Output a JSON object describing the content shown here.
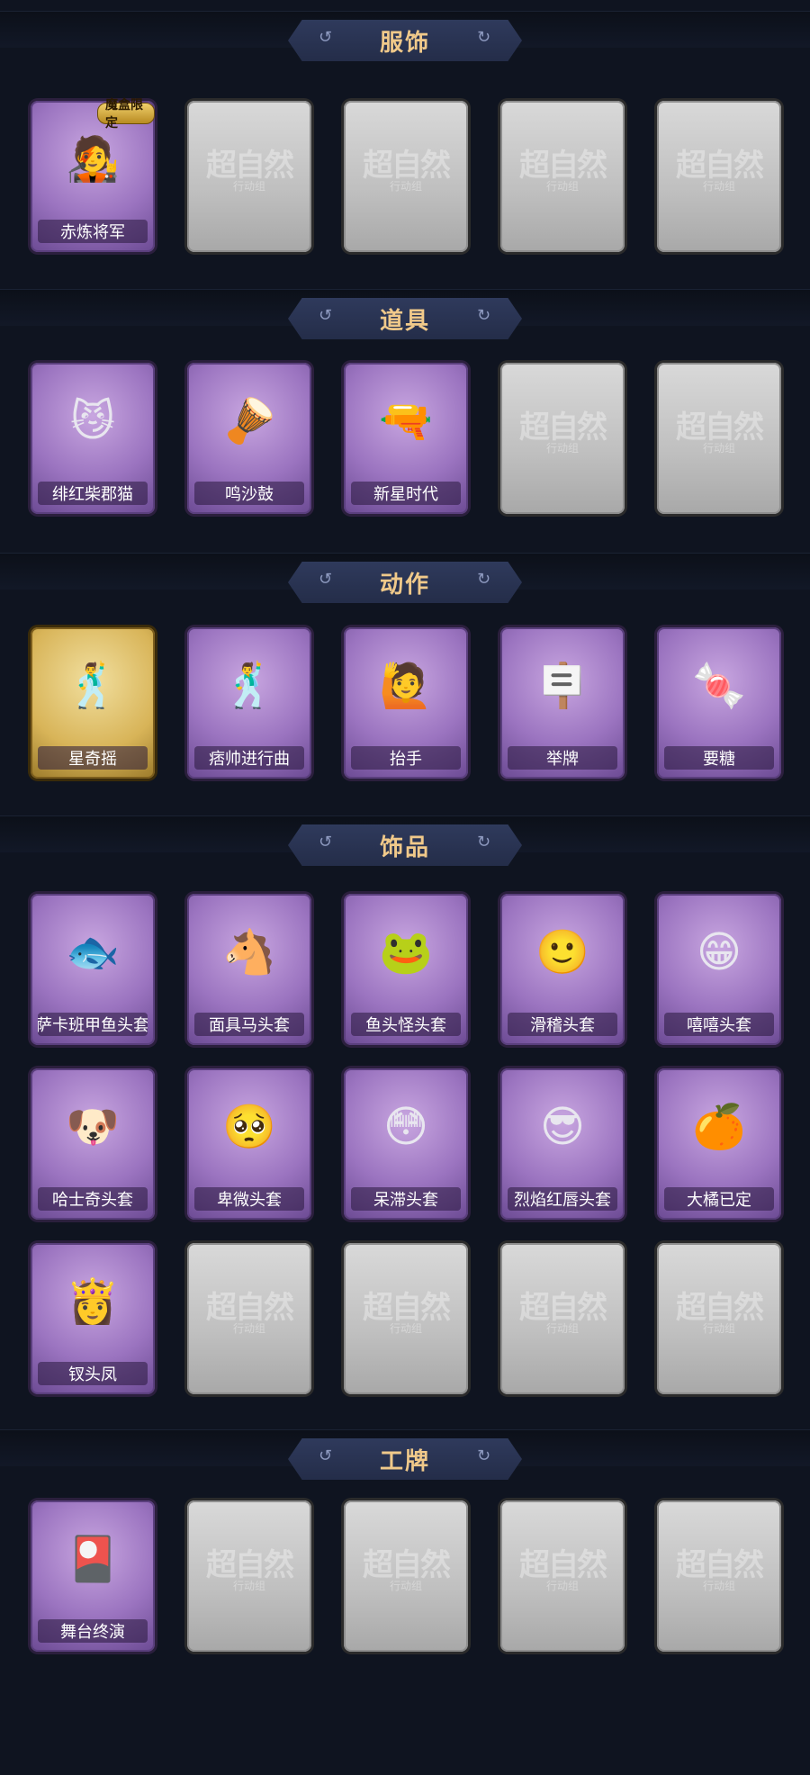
{
  "sections": [
    {
      "title": "服饰",
      "rows": [
        [
          {
            "type": "filled",
            "label": "赤炼将军",
            "icon": "red-hat-avatar-icon",
            "badge": "魔盒限定"
          },
          {
            "type": "empty",
            "watermark": "超自然",
            "watermark_sub": "行动组"
          },
          {
            "type": "empty",
            "watermark": "超自然",
            "watermark_sub": "行动组"
          },
          {
            "type": "empty",
            "watermark": "超自然",
            "watermark_sub": "行动组"
          },
          {
            "type": "empty",
            "watermark": "超自然",
            "watermark_sub": "行动组"
          }
        ]
      ]
    },
    {
      "title": "道具",
      "rows": [
        [
          {
            "type": "filled",
            "label": "绯红柴郡猫",
            "icon": "cheshire-cat-icon"
          },
          {
            "type": "filled",
            "label": "鸣沙鼓",
            "icon": "drum-charm-icon"
          },
          {
            "type": "filled",
            "label": "新星时代",
            "icon": "revolver-icon"
          },
          {
            "type": "empty",
            "watermark": "超自然",
            "watermark_sub": "行动组"
          },
          {
            "type": "empty",
            "watermark": "超自然",
            "watermark_sub": "行动组"
          }
        ]
      ]
    },
    {
      "title": "动作",
      "rows": [
        [
          {
            "type": "gold",
            "label": "星奇摇",
            "icon": "dance-pose-icon"
          },
          {
            "type": "filled",
            "label": "痞帅进行曲",
            "icon": "dance-pose-icon"
          },
          {
            "type": "filled",
            "label": "抬手",
            "icon": "raise-hand-icon"
          },
          {
            "type": "filled",
            "label": "举牌",
            "icon": "hold-sign-icon"
          },
          {
            "type": "filled",
            "label": "要糖",
            "icon": "ask-candy-icon"
          }
        ]
      ]
    },
    {
      "title": "饰品",
      "rows": [
        [
          {
            "type": "filled",
            "label": "萨卡班甲鱼头套",
            "icon": "fish-head-icon"
          },
          {
            "type": "filled",
            "label": "面具马头套",
            "icon": "horse-head-icon"
          },
          {
            "type": "filled",
            "label": "鱼头怪头套",
            "icon": "fish-monster-icon"
          },
          {
            "type": "filled",
            "label": "滑稽头套",
            "icon": "smile-face-icon"
          },
          {
            "type": "filled",
            "label": "嘻嘻头套",
            "icon": "grin-face-icon"
          }
        ],
        [
          {
            "type": "filled",
            "label": "哈士奇头套",
            "icon": "husky-head-icon"
          },
          {
            "type": "filled",
            "label": "卑微头套",
            "icon": "shy-face-icon"
          },
          {
            "type": "filled",
            "label": "呆滞头套",
            "icon": "stare-face-icon"
          },
          {
            "type": "filled",
            "label": "烈焰红唇头套",
            "icon": "pikachu-head-icon"
          },
          {
            "type": "filled",
            "label": "大橘已定",
            "icon": "orange-slice-icon"
          }
        ],
        [
          {
            "type": "filled",
            "label": "钗头凤",
            "icon": "phoenix-crown-icon"
          },
          {
            "type": "empty",
            "watermark": "超自然",
            "watermark_sub": "行动组"
          },
          {
            "type": "empty",
            "watermark": "超自然",
            "watermark_sub": "行动组"
          },
          {
            "type": "empty",
            "watermark": "超自然",
            "watermark_sub": "行动组"
          },
          {
            "type": "empty",
            "watermark": "超自然",
            "watermark_sub": "行动组"
          }
        ]
      ]
    },
    {
      "title": "工牌",
      "rows": [
        [
          {
            "type": "filled",
            "label": "舞台终演",
            "icon": "stage-card-icon"
          },
          {
            "type": "empty",
            "watermark": "超自然",
            "watermark_sub": "行动组"
          },
          {
            "type": "empty",
            "watermark": "超自然",
            "watermark_sub": "行动组"
          },
          {
            "type": "empty",
            "watermark": "超自然",
            "watermark_sub": "行动组"
          },
          {
            "type": "empty",
            "watermark": "超自然",
            "watermark_sub": "行动组"
          }
        ]
      ]
    }
  ]
}
